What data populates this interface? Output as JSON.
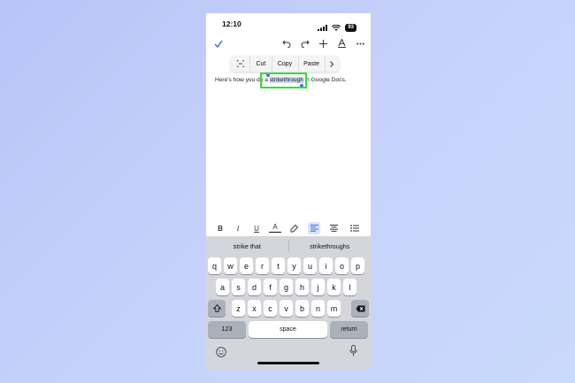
{
  "status_bar": {
    "time": "12:10",
    "battery": "93"
  },
  "context_menu": {
    "items": [
      "Cut",
      "Copy",
      "Paste"
    ]
  },
  "document": {
    "before_text": "Here's how you do a ",
    "selected_text": "strikethrough",
    "after_text": " in Google Docs."
  },
  "format_bar": {
    "bold": "B",
    "italic": "I",
    "underline": "U",
    "text_color": "A"
  },
  "suggestions": [
    "strike that",
    "strikethroughs"
  ],
  "keyboard": {
    "row1": [
      "q",
      "w",
      "e",
      "r",
      "t",
      "y",
      "u",
      "i",
      "o",
      "p"
    ],
    "row2": [
      "a",
      "s",
      "d",
      "f",
      "g",
      "h",
      "j",
      "k",
      "l"
    ],
    "row3": [
      "z",
      "x",
      "c",
      "v",
      "b",
      "n",
      "m"
    ],
    "numbers_label": "123",
    "space_label": "space",
    "return_label": "return"
  },
  "colors": {
    "accent": "#3f6fe0",
    "highlight": "#2ee22e",
    "selection": "#c9d8f6"
  }
}
